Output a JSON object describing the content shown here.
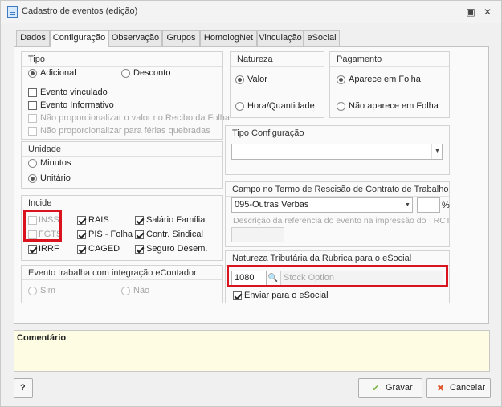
{
  "window": {
    "title": "Cadastro de eventos (edição)",
    "icons": [
      "app-icon",
      "restore-icon",
      "close-icon"
    ],
    "restore_glyph": "▣",
    "close_glyph": "✕"
  },
  "tabs": [
    {
      "label": "Dados",
      "active": false
    },
    {
      "label": "Configuração",
      "active": true
    },
    {
      "label": "Observação",
      "active": false
    },
    {
      "label": "Grupos",
      "active": false
    },
    {
      "label": "HomologNet",
      "active": false
    },
    {
      "label": "Vinculação",
      "active": false
    },
    {
      "label": "eSocial",
      "active": false
    }
  ],
  "tipo": {
    "title": "Tipo",
    "options": [
      {
        "label": "Adicional",
        "selected": true
      },
      {
        "label": "Desconto",
        "selected": false
      }
    ],
    "checks": [
      {
        "label": "Evento vinculado",
        "checked": false,
        "disabled": false
      },
      {
        "label": "Evento Informativo",
        "checked": false,
        "disabled": false
      },
      {
        "label": "Não proporcionalizar o valor no Recibo da Folha",
        "checked": false,
        "disabled": true
      },
      {
        "label": "Não proporcionalizar para férias quebradas",
        "checked": false,
        "disabled": true
      }
    ]
  },
  "unidade": {
    "title": "Unidade",
    "options": [
      {
        "label": "Minutos",
        "selected": false
      },
      {
        "label": "Unitário",
        "selected": true
      }
    ]
  },
  "incide": {
    "title": "Incide",
    "items": [
      {
        "label": "INSS",
        "checked": false,
        "disabled": true
      },
      {
        "label": "FGTS",
        "checked": false,
        "disabled": true
      },
      {
        "label": "IRRF",
        "checked": true,
        "disabled": false
      },
      {
        "label": "RAIS",
        "checked": true,
        "disabled": false
      },
      {
        "label": "PIS - Folha",
        "checked": true,
        "disabled": false
      },
      {
        "label": "CAGED",
        "checked": true,
        "disabled": false
      },
      {
        "label": "Salário Família",
        "checked": true,
        "disabled": false
      },
      {
        "label": "Contr. Sindical",
        "checked": true,
        "disabled": false
      },
      {
        "label": "Seguro Desem.",
        "checked": true,
        "disabled": false
      }
    ]
  },
  "econtador": {
    "title": "Evento trabalha com integração eContador",
    "options": [
      {
        "label": "Sim",
        "selected": false
      },
      {
        "label": "Não",
        "selected": false
      }
    ]
  },
  "natureza": {
    "title": "Natureza",
    "options": [
      {
        "label": "Valor",
        "selected": true
      },
      {
        "label": "Hora/Quantidade",
        "selected": false
      }
    ]
  },
  "pagamento": {
    "title": "Pagamento",
    "options": [
      {
        "label": "Aparece em Folha",
        "selected": true
      },
      {
        "label": "Não aparece em Folha",
        "selected": false
      }
    ]
  },
  "tipo_config": {
    "title": "Tipo Configuração",
    "value": ""
  },
  "rescisao": {
    "title": "Campo no Termo de Rescisão de Contrato de Trabalho",
    "value": "095-Outras Verbas",
    "percent_value": "",
    "percent_symbol": "%",
    "descricao_label": "Descrição da referência do evento na impressão do TRCT",
    "descricao_value": ""
  },
  "natureza_tributaria": {
    "title": "Natureza Tributária da Rubrica para o eSocial",
    "code": "1080",
    "search_glyph": "🔍",
    "description_placeholder": "Stock Option",
    "enviar_label": "Enviar para o eSocial",
    "enviar_checked": true
  },
  "comentario": {
    "title": "Comentário",
    "value": ""
  },
  "footer": {
    "help_label": "?",
    "gravar_label": "Gravar",
    "cancelar_label": "Cancelar",
    "gravar_glyph": "✔",
    "cancelar_glyph": "✖"
  },
  "colors": {
    "highlight": "#d9141e",
    "comment_bg": "#fefde3",
    "gravar_icon": "#7cb342",
    "cancelar_icon": "#e0542a"
  }
}
